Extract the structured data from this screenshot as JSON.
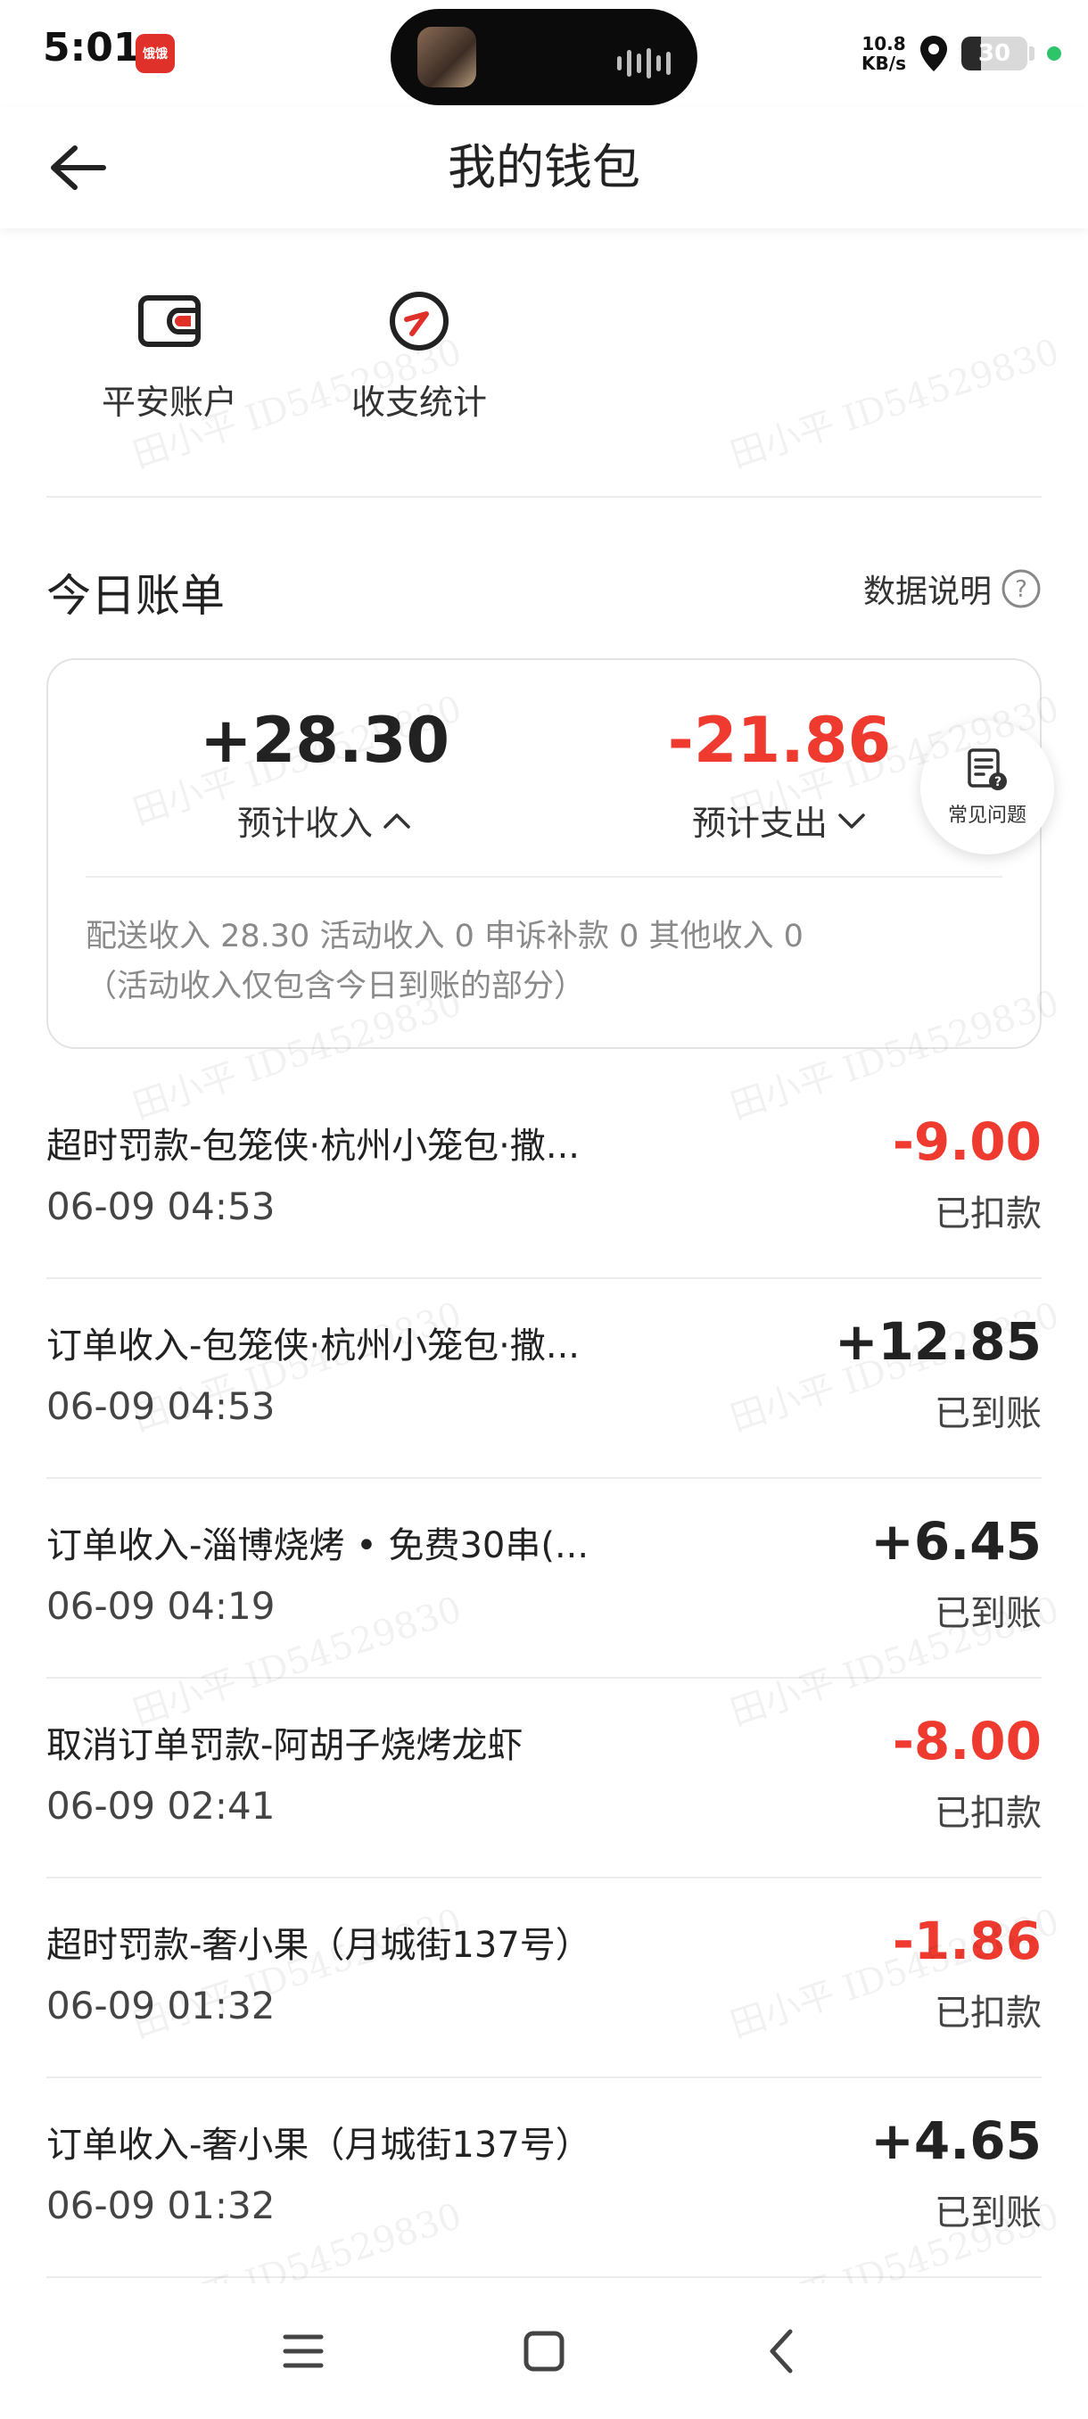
{
  "status_bar": {
    "time": "5:01",
    "app_badge": "饿饿",
    "net_speed_value": "10.8",
    "net_speed_unit": "KB/s",
    "battery": "30"
  },
  "header": {
    "title": "我的钱包"
  },
  "shortcuts": [
    {
      "label": "平安账户",
      "icon": "wallet-icon"
    },
    {
      "label": "收支统计",
      "icon": "stats-icon"
    }
  ],
  "today": {
    "title": "今日账单",
    "data_note": "数据说明",
    "income_amount": "+28.30",
    "income_label": "预计收入",
    "expense_amount": "-21.86",
    "expense_label": "预计支出",
    "breakdown_line1": "配送收入 28.30 活动收入 0 申诉补款 0 其他收入 0",
    "breakdown_line2": "（活动收入仅包含今日到账的部分）",
    "faq_label": "常见问题"
  },
  "transactions": [
    {
      "title": "超时罚款-包笼侠·杭州小笼包·撒...",
      "time": "06-09 04:53",
      "amount": "-9.00",
      "status": "已扣款"
    },
    {
      "title": "订单收入-包笼侠·杭州小笼包·撒...",
      "time": "06-09 04:53",
      "amount": "+12.85",
      "status": "已到账"
    },
    {
      "title": "订单收入-淄博烧烤 • 免费30串(...",
      "time": "06-09 04:19",
      "amount": "+6.45",
      "status": "已到账"
    },
    {
      "title": "取消订单罚款-阿胡子烧烤龙虾",
      "time": "06-09 02:41",
      "amount": "-8.00",
      "status": "已扣款"
    },
    {
      "title": "超时罚款-奢小果（月城街137号）",
      "time": "06-09 01:32",
      "amount": "-1.86",
      "status": "已扣款"
    },
    {
      "title": "订单收入-奢小果（月城街137号）",
      "time": "06-09 01:32",
      "amount": "+4.65",
      "status": "已到账"
    }
  ],
  "watermark": "田小平 ID54529830",
  "colors": {
    "negative": "#ee3a2f",
    "positive": "#222222",
    "accent_red": "#e0302a"
  }
}
